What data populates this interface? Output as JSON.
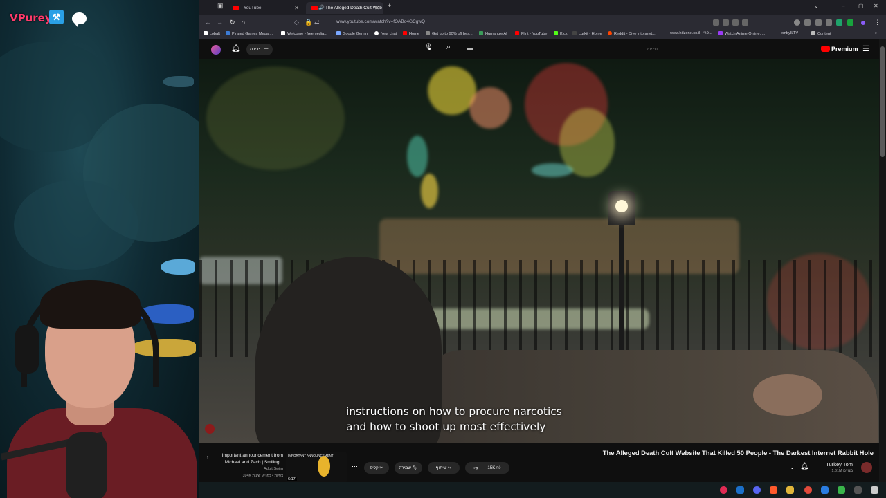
{
  "streamer": {
    "name": "VPureyy"
  },
  "browser": {
    "tabs": [
      {
        "label": "YouTube"
      },
      {
        "label": "The Alleged Death Cult Web"
      }
    ],
    "url": "www.youtube.com/watch?v=fOABo4GCgwQ",
    "bookmarks": [
      "cobalt",
      "Pirated Games Mega ...",
      "Welcome • freemedia...",
      "Google Gemini",
      "New chat",
      "Home",
      "Get up to 90% off bes...",
      "Humanize AI",
      "Flint - YouTube",
      "Kick",
      "Lurkit - Home",
      "Reddit - Dive into anyt...",
      "www.hdzone.co.il - פרי...",
      "Watch Anime Online, ...",
      "embyILTV",
      "Content"
    ]
  },
  "youtube": {
    "create_label": "יצירה",
    "search_placeholder": "חיפוש",
    "logo_label": "Premium"
  },
  "video": {
    "captions": [
      "instructions on how to procure narcotics",
      "and how to shoot up most effectively"
    ],
    "title": "The Alleged Death Cult Website That Killed 50 People - The Darkest Internet Rabbit Hole",
    "channel": "Turkey Tom",
    "subscribers": "1.61M מנויים",
    "likes": "15K",
    "share_label": "שיתוף",
    "save_label": "שמירה",
    "clip_label": "קליפ"
  },
  "recommended": {
    "title": "Important announcement from Michael and Zach | Smiling...",
    "channel": "Adult Swim",
    "meta": "394K צפיות • לפני 9 שעות",
    "duration": "6:17",
    "thumb_text": "IMPORTANT ANNOUNCEMENT"
  },
  "colors": {
    "accent": "#ff0000",
    "streamer_name": "#ff3b6b"
  }
}
